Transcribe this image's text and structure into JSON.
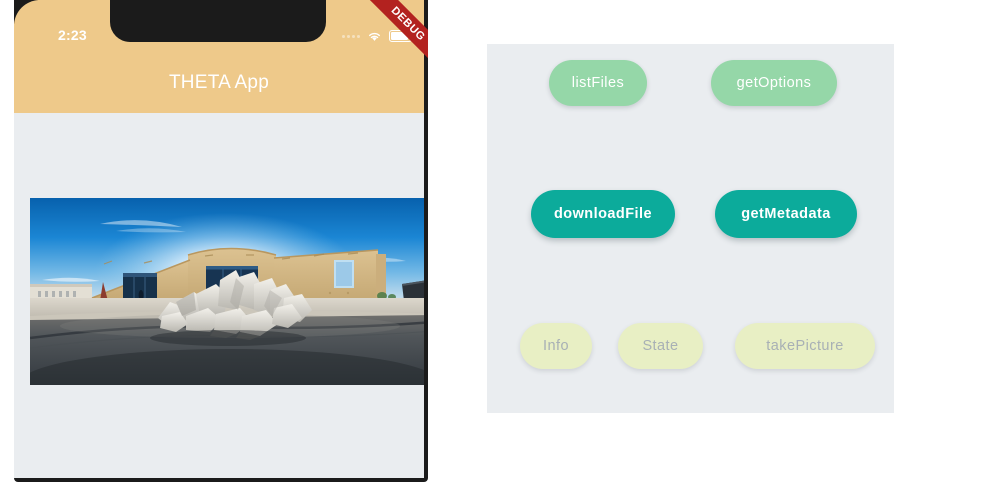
{
  "phone": {
    "status_bar": {
      "time": "2:23",
      "signal_icon": "signal-dots-icon",
      "wifi_icon": "wifi-icon",
      "battery_icon": "battery-icon"
    },
    "app_bar": {
      "title": "THETA App"
    },
    "debug_banner": {
      "label": "DEBUG",
      "color": "#b3221f"
    },
    "content": {
      "photo_alt": "360 panorama of building exterior with pile of white boulders",
      "photo_description": "Equirectangular panorama: tan stucco building with glass entry doors, blue sky with sun flare above the roofline, and a cluster of large pale rocks on grey asphalt pavement in the foreground."
    }
  },
  "panel": {
    "background": "#eaedf0",
    "rows": [
      {
        "style": "light",
        "buttons": [
          {
            "id": "listFiles",
            "label": "listFiles"
          },
          {
            "id": "getOptions",
            "label": "getOptions"
          }
        ]
      },
      {
        "style": "strong",
        "buttons": [
          {
            "id": "downloadFile",
            "label": "downloadFile"
          },
          {
            "id": "getMetadata",
            "label": "getMetadata"
          }
        ]
      },
      {
        "style": "disabled",
        "buttons": [
          {
            "id": "Info",
            "label": "Info"
          },
          {
            "id": "State",
            "label": "State"
          },
          {
            "id": "takePicture",
            "label": "takePicture"
          }
        ]
      }
    ]
  },
  "colors": {
    "page_background": "#ffffff",
    "app_bar": "#eec98a",
    "screen_background": "#eaedf0",
    "phone_frame": "#1b1b1b",
    "button_light": "#95d7a8",
    "button_strong": "#0cab9b",
    "button_disabled": "#e8efc4",
    "button_disabled_text": "#a8b0b5"
  }
}
